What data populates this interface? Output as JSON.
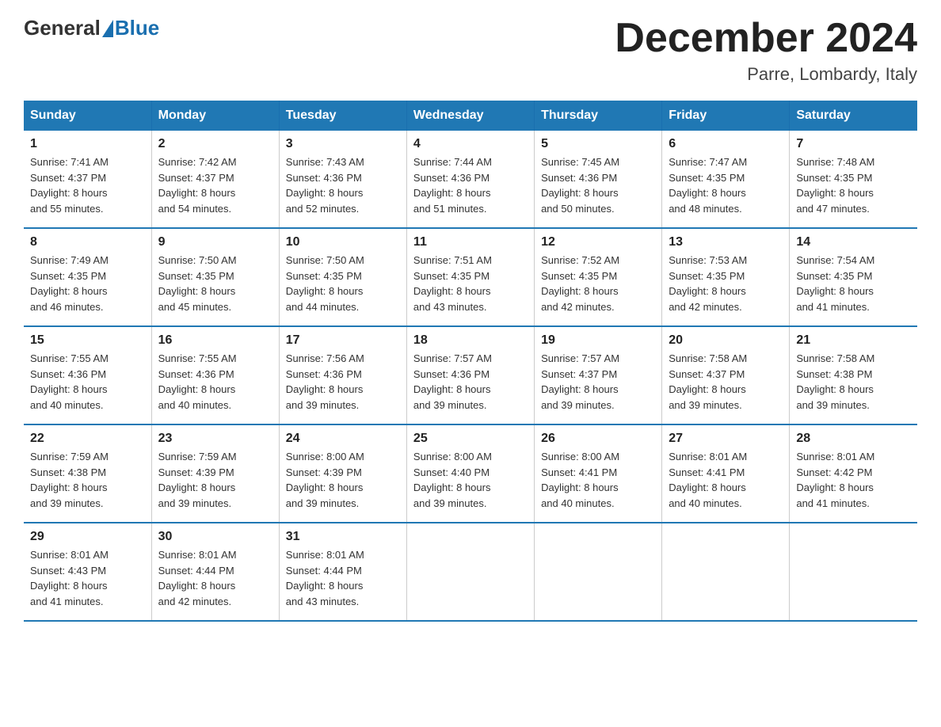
{
  "header": {
    "logo_general": "General",
    "logo_blue": "Blue",
    "month_title": "December 2024",
    "location": "Parre, Lombardy, Italy"
  },
  "weekdays": [
    "Sunday",
    "Monday",
    "Tuesday",
    "Wednesday",
    "Thursday",
    "Friday",
    "Saturday"
  ],
  "weeks": [
    [
      {
        "day": "1",
        "sunrise": "7:41 AM",
        "sunset": "4:37 PM",
        "daylight": "8 hours and 55 minutes."
      },
      {
        "day": "2",
        "sunrise": "7:42 AM",
        "sunset": "4:37 PM",
        "daylight": "8 hours and 54 minutes."
      },
      {
        "day": "3",
        "sunrise": "7:43 AM",
        "sunset": "4:36 PM",
        "daylight": "8 hours and 52 minutes."
      },
      {
        "day": "4",
        "sunrise": "7:44 AM",
        "sunset": "4:36 PM",
        "daylight": "8 hours and 51 minutes."
      },
      {
        "day": "5",
        "sunrise": "7:45 AM",
        "sunset": "4:36 PM",
        "daylight": "8 hours and 50 minutes."
      },
      {
        "day": "6",
        "sunrise": "7:47 AM",
        "sunset": "4:35 PM",
        "daylight": "8 hours and 48 minutes."
      },
      {
        "day": "7",
        "sunrise": "7:48 AM",
        "sunset": "4:35 PM",
        "daylight": "8 hours and 47 minutes."
      }
    ],
    [
      {
        "day": "8",
        "sunrise": "7:49 AM",
        "sunset": "4:35 PM",
        "daylight": "8 hours and 46 minutes."
      },
      {
        "day": "9",
        "sunrise": "7:50 AM",
        "sunset": "4:35 PM",
        "daylight": "8 hours and 45 minutes."
      },
      {
        "day": "10",
        "sunrise": "7:50 AM",
        "sunset": "4:35 PM",
        "daylight": "8 hours and 44 minutes."
      },
      {
        "day": "11",
        "sunrise": "7:51 AM",
        "sunset": "4:35 PM",
        "daylight": "8 hours and 43 minutes."
      },
      {
        "day": "12",
        "sunrise": "7:52 AM",
        "sunset": "4:35 PM",
        "daylight": "8 hours and 42 minutes."
      },
      {
        "day": "13",
        "sunrise": "7:53 AM",
        "sunset": "4:35 PM",
        "daylight": "8 hours and 42 minutes."
      },
      {
        "day": "14",
        "sunrise": "7:54 AM",
        "sunset": "4:35 PM",
        "daylight": "8 hours and 41 minutes."
      }
    ],
    [
      {
        "day": "15",
        "sunrise": "7:55 AM",
        "sunset": "4:36 PM",
        "daylight": "8 hours and 40 minutes."
      },
      {
        "day": "16",
        "sunrise": "7:55 AM",
        "sunset": "4:36 PM",
        "daylight": "8 hours and 40 minutes."
      },
      {
        "day": "17",
        "sunrise": "7:56 AM",
        "sunset": "4:36 PM",
        "daylight": "8 hours and 39 minutes."
      },
      {
        "day": "18",
        "sunrise": "7:57 AM",
        "sunset": "4:36 PM",
        "daylight": "8 hours and 39 minutes."
      },
      {
        "day": "19",
        "sunrise": "7:57 AM",
        "sunset": "4:37 PM",
        "daylight": "8 hours and 39 minutes."
      },
      {
        "day": "20",
        "sunrise": "7:58 AM",
        "sunset": "4:37 PM",
        "daylight": "8 hours and 39 minutes."
      },
      {
        "day": "21",
        "sunrise": "7:58 AM",
        "sunset": "4:38 PM",
        "daylight": "8 hours and 39 minutes."
      }
    ],
    [
      {
        "day": "22",
        "sunrise": "7:59 AM",
        "sunset": "4:38 PM",
        "daylight": "8 hours and 39 minutes."
      },
      {
        "day": "23",
        "sunrise": "7:59 AM",
        "sunset": "4:39 PM",
        "daylight": "8 hours and 39 minutes."
      },
      {
        "day": "24",
        "sunrise": "8:00 AM",
        "sunset": "4:39 PM",
        "daylight": "8 hours and 39 minutes."
      },
      {
        "day": "25",
        "sunrise": "8:00 AM",
        "sunset": "4:40 PM",
        "daylight": "8 hours and 39 minutes."
      },
      {
        "day": "26",
        "sunrise": "8:00 AM",
        "sunset": "4:41 PM",
        "daylight": "8 hours and 40 minutes."
      },
      {
        "day": "27",
        "sunrise": "8:01 AM",
        "sunset": "4:41 PM",
        "daylight": "8 hours and 40 minutes."
      },
      {
        "day": "28",
        "sunrise": "8:01 AM",
        "sunset": "4:42 PM",
        "daylight": "8 hours and 41 minutes."
      }
    ],
    [
      {
        "day": "29",
        "sunrise": "8:01 AM",
        "sunset": "4:43 PM",
        "daylight": "8 hours and 41 minutes."
      },
      {
        "day": "30",
        "sunrise": "8:01 AM",
        "sunset": "4:44 PM",
        "daylight": "8 hours and 42 minutes."
      },
      {
        "day": "31",
        "sunrise": "8:01 AM",
        "sunset": "4:44 PM",
        "daylight": "8 hours and 43 minutes."
      },
      null,
      null,
      null,
      null
    ]
  ],
  "labels": {
    "sunrise_prefix": "Sunrise: ",
    "sunset_prefix": "Sunset: ",
    "daylight_prefix": "Daylight: "
  }
}
